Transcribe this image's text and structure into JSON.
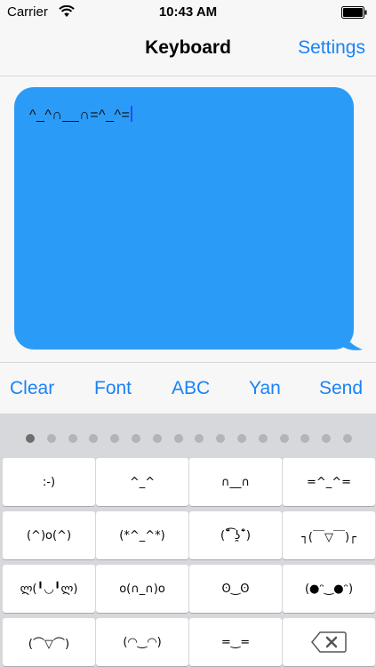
{
  "status_bar": {
    "carrier": "Carrier",
    "time": "10:43 AM"
  },
  "nav": {
    "title": "Keyboard",
    "settings_label": "Settings"
  },
  "editor": {
    "text": "^_^∩__∩=^_^=",
    "bubble_color": "#2b9bf8"
  },
  "toolbar": {
    "clear_label": "Clear",
    "font_label": "Font",
    "abc_label": "ABC",
    "yan_label": "Yan",
    "send_label": "Send",
    "accent_color": "#1a82f7"
  },
  "keyboard": {
    "page_count": 16,
    "active_page": 1,
    "rows": [
      [
        ":-)",
        "^_^",
        "∩__∩",
        "=^_^="
      ],
      [
        "(^)o(^)",
        "(*^_^*)",
        "(¯͒͡ ʖ̯¯͒)",
        "┐(￣▽￣)┌"
      ],
      [
        "ლ(╹◡╹ლ)",
        "o(∩_∩)o",
        "ʘ‿ʘ",
        "(●ᵔ‿●ᵔ)"
      ],
      [
        "(⌒▽⌒)",
        "(◠‿◠)",
        "=‿=",
        "delete-icon"
      ]
    ]
  }
}
